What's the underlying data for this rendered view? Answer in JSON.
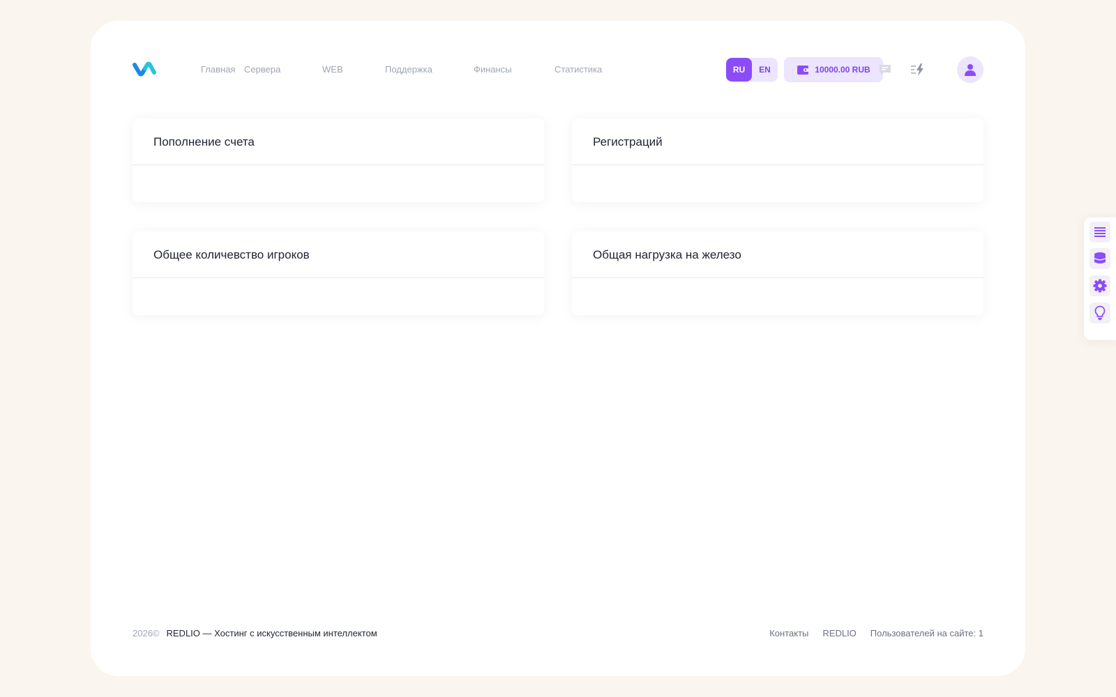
{
  "header": {
    "nav": [
      "Главная",
      "Сервера",
      "WEB",
      "Поддержка",
      "Финансы",
      "Статистика"
    ],
    "lang_ru": "RU",
    "lang_en": "EN",
    "balance": "10000.00 RUB"
  },
  "cards": [
    {
      "title": "Пополнение счета"
    },
    {
      "title": "Регистраций"
    },
    {
      "title": "Общее количевство игроков"
    },
    {
      "title": "Общая нагрузка на железо"
    }
  ],
  "footer": {
    "year": "2026©",
    "tagline": "REDLIO — Хостинг с искусственным интеллектом",
    "contacts": "Контакты",
    "brand": "REDLIO",
    "users_online": "Пользователей на сайте: 1"
  },
  "colors": {
    "accent": "#8b4cf7",
    "accent_light": "#ede4fe",
    "background": "#faf6ef",
    "logo_blue": "#1e88e5",
    "logo_teal": "#26c6da"
  },
  "icons": {
    "logo": "wave-logo-icon",
    "wallet": "wallet-icon",
    "chat": "chat-icon",
    "activity": "lightning-icon",
    "user": "user-icon",
    "side": [
      "list-icon",
      "database-icon",
      "gear-icon",
      "lightbulb-icon"
    ]
  }
}
